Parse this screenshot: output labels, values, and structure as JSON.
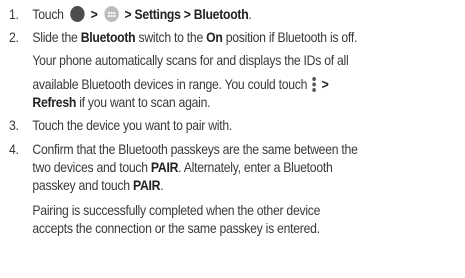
{
  "steps": [
    {
      "number": "1.",
      "lines": [
        {
          "t1": "Touch",
          "sep1": ">",
          "sep2": "> Settings > Bluetooth",
          "end": "."
        }
      ]
    },
    {
      "number": "2.",
      "lines": [
        {
          "a": "Slide the ",
          "b1": "Bluetooth",
          "c": " switch to the ",
          "b2": "On",
          "d": " position if Bluetooth is off."
        },
        {
          "text": "Your phone automatically scans for and displays the IDs of all"
        },
        {
          "text": "available Bluetooth devices in range. You could touch",
          "after": ">"
        },
        {
          "bold": "Refresh",
          "rest": " if you want to scan again."
        }
      ]
    },
    {
      "number": "3.",
      "lines": [
        {
          "text": "Touch the device you want to pair with."
        }
      ]
    },
    {
      "number": "4.",
      "lines": [
        {
          "text": "Confirm that the Bluetooth passkeys are the same between the"
        },
        {
          "a": "two devices and touch ",
          "bold": "PAIR",
          "c": ". Alternately, enter a Bluetooth"
        },
        {
          "a": "passkey and touch ",
          "bold": "PAIR",
          "c": "."
        },
        {
          "text": "Pairing is successfully completed when the other device"
        },
        {
          "text": "accepts the connection or the same passkey is entered."
        }
      ]
    }
  ],
  "icons": {
    "home": "home-button-icon",
    "apps": "apps-icon",
    "menu": "more-options-icon"
  }
}
